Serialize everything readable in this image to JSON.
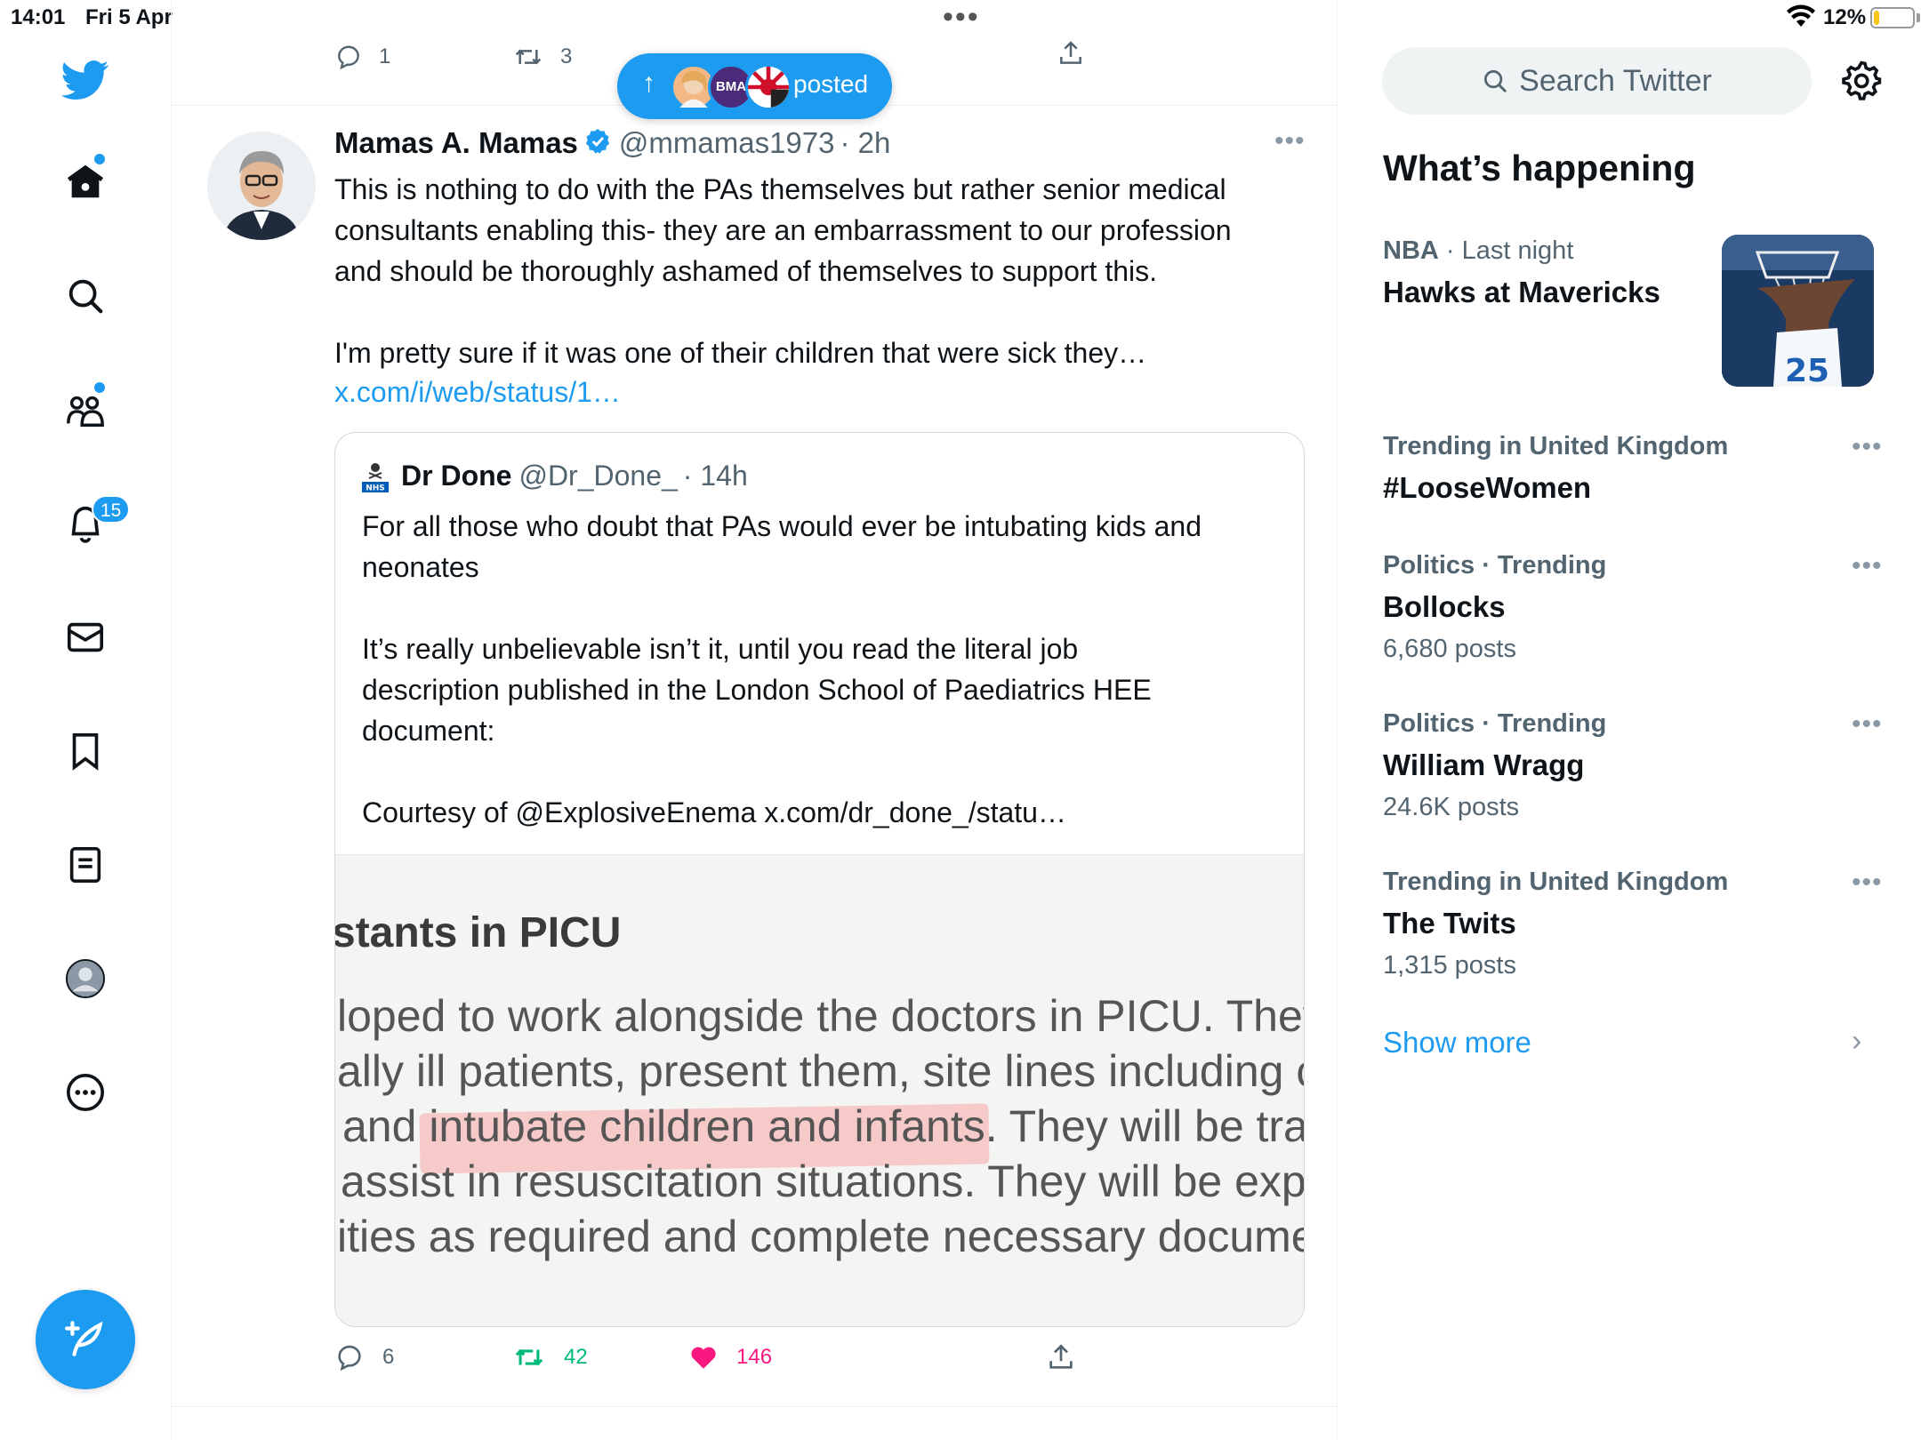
{
  "status_bar": {
    "time": "14:01",
    "date": "Fri 5 Apr",
    "battery_pct": "12%",
    "battery_level": 0.12
  },
  "colors": {
    "accent": "#1d9bf0",
    "like": "#f91880",
    "retweet": "#00ba7c",
    "muted": "#536471"
  },
  "nav": {
    "items": [
      {
        "name": "twitter-logo",
        "icon": "bird-icon"
      },
      {
        "name": "home",
        "icon": "home-icon",
        "dot": true
      },
      {
        "name": "explore",
        "icon": "search-icon"
      },
      {
        "name": "communities",
        "icon": "people-icon",
        "dot": true
      },
      {
        "name": "notifications",
        "icon": "bell-icon",
        "badge": "15"
      },
      {
        "name": "messages",
        "icon": "mail-icon"
      },
      {
        "name": "bookmarks",
        "icon": "bookmark-icon"
      },
      {
        "name": "lists",
        "icon": "list-icon"
      },
      {
        "name": "profile",
        "icon": "avatar-icon"
      },
      {
        "name": "more",
        "icon": "more-icon"
      }
    ],
    "compose_icon": "compose-icon"
  },
  "previous_tweet": {
    "replies": "1",
    "retweets": "3"
  },
  "posted_pill": {
    "label": "posted",
    "avatar_text": "BMA"
  },
  "tweet": {
    "name": "Mamas A. Mamas",
    "handle": "@mmamas1973",
    "time": "· 2h",
    "body": "This is nothing to do with the PAs themselves but rather senior medical\nconsultants enabling this- they are an embarrassment to our profession\nand should be thoroughly ashamed of themselves to support this.\n\nI'm pretty sure if it was one of their children that were sick they…",
    "link": "x.com/i/web/status/1…",
    "quote": {
      "name": "Dr Done",
      "handle": "@Dr_Done_",
      "time": "· 14h",
      "body": "For all those who doubt that PAs would ever be intubating kids and\nneonates\n\nIt’s really unbelievable isn’t it, until you read the literal job\ndescription published in the London School of Paediatrics HEE\ndocument:\n\nCourtesy of @ExplosiveEnema x.com/dr_done_/statu…",
      "image": {
        "heading": "stants in PICU",
        "lines": [
          "loped to work alongside the doctors in PICU. They",
          "ally ill patients, present them, site lines including ce",
          "and intubate children and infants. They will be tra",
          "assist in resuscitation situations. They will be expec",
          "ities as required and complete necessary document"
        ]
      }
    },
    "actions": {
      "replies": "6",
      "retweets": "42",
      "likes": "146"
    }
  },
  "sidebar": {
    "search_placeholder": "Search Twitter",
    "title": "What’s happening",
    "trends": [
      {
        "category": "NBA",
        "meta": " · Last night",
        "name": "Hawks at Mavericks",
        "count": ""
      },
      {
        "category": "",
        "meta": "Trending in United Kingdom",
        "name": "#LooseWomen",
        "count": ""
      },
      {
        "category": "",
        "meta": "Politics · Trending",
        "name": "Bollocks",
        "count": "6,680 posts"
      },
      {
        "category": "",
        "meta": "Politics · Trending",
        "name": "William Wragg",
        "count": "24.6K posts"
      },
      {
        "category": "",
        "meta": "Trending in United Kingdom",
        "name": "The Twits",
        "count": "1,315 posts"
      }
    ],
    "show_more": "Show more"
  }
}
